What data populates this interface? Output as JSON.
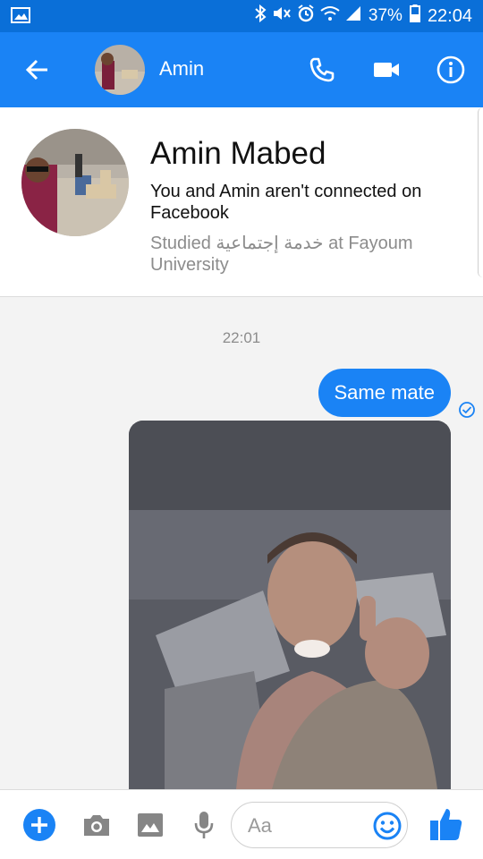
{
  "status_bar": {
    "battery": "37%",
    "time": "22:04"
  },
  "header": {
    "contact_name": "Amin"
  },
  "profile": {
    "full_name": "Amin Mabed",
    "connection_note": "You and Amin aren't connected on Facebook",
    "education": "Studied خدمة إجتماعية at Fayoum University"
  },
  "conversation": {
    "timestamp": "22:01",
    "messages": [
      {
        "text": "Same mate"
      }
    ]
  },
  "composer": {
    "placeholder": "Aa"
  },
  "colors": {
    "status_bar": "#0a6fd8",
    "header": "#1a83f5",
    "accent": "#1a83f5",
    "background": "#f3f3f3"
  }
}
